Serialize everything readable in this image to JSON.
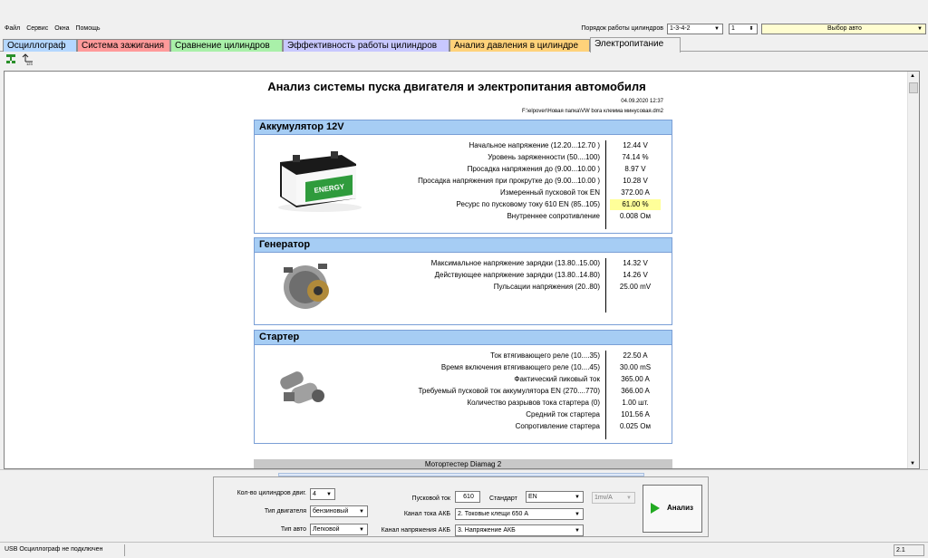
{
  "menu": {
    "items": [
      "Файл",
      "Сервис",
      "Окна",
      "Помощь"
    ]
  },
  "topbar": {
    "firing_order_label": "Порядок работы цилиндров",
    "firing_order": "1-3-4-2",
    "cylinder": "1",
    "car_select": "Выбор авто"
  },
  "tabs": [
    {
      "label": "Осциллограф",
      "color": "#b4d7ff"
    },
    {
      "label": "Система зажигания",
      "color": "#ff9a9a"
    },
    {
      "label": "Сравнение цилиндров",
      "color": "#a9f0a9"
    },
    {
      "label": "Эффективность работы цилиндров",
      "color": "#c8c8ff"
    },
    {
      "label": "Анализ давления в цилиндре",
      "color": "#ffd27a"
    },
    {
      "label": "Электропитание",
      "color": "#f0f0f0"
    }
  ],
  "report": {
    "title": "Анализ системы пуска двигателя и электропитания автомобиля",
    "date": "04.09.2020 12:37",
    "path": "F:\\elpover\\Новая папка\\VW bora клемма минусовая.dm2",
    "footer": "Мотортестер Diamag 2",
    "sections": [
      {
        "title": "Аккумулятор 12V",
        "rows": [
          {
            "label": "Начальное напряжение (12.20...12.70 )",
            "value": "12.44 V"
          },
          {
            "label": "Уровень заряженности (50....100)",
            "value": "74.14 %"
          },
          {
            "label": "Просадка напряжения до (9.00...10.00 )",
            "value": "8.97 V"
          },
          {
            "label": "Просадка напряжения при прокрутке до (9.00...10.00 )",
            "value": "10.28 V"
          },
          {
            "label": "Измеренный пусковой ток  EN",
            "value": "372.00 A"
          },
          {
            "label": "Ресурс по пусковому току  610 EN (85..105)",
            "value": "61.00 %",
            "highlight": true
          },
          {
            "label": "Внутреннее сопротивление",
            "value": "0.008 Ом"
          }
        ]
      },
      {
        "title": "Генератор",
        "rows": [
          {
            "label": "Максимальное напряжение зарядки  (13.80..15.00)",
            "value": "14.32 V"
          },
          {
            "label": "Действующее напряжение зарядки (13.80..14.80)",
            "value": "14.26 V"
          },
          {
            "label": "Пульсации напряжения (20..80)",
            "value": "25.00 mV"
          }
        ]
      },
      {
        "title": "Стартер",
        "rows": [
          {
            "label": "Ток втягивающего реле (10....35)",
            "value": "22.50 A"
          },
          {
            "label": "Время включения втягивающего реле (10....45)",
            "value": "30.00 mS"
          },
          {
            "label": "Фактический пиковый ток",
            "value": "365.00 A"
          },
          {
            "label": "Требуемый пусковой ток аккумулятора  EN (270....770)",
            "value": "366.00 A"
          },
          {
            "label": "Количество разрывов тока стартера (0)",
            "value": "1.00 шт."
          },
          {
            "label": "Средний ток стартера",
            "value": "101.56 A"
          },
          {
            "label": "Сопротивление стартера",
            "value": "0.025 Ом"
          }
        ]
      }
    ]
  },
  "controls": {
    "cyl_count_label": "Кол-во цилиндров двиг.",
    "cyl_count": "4",
    "engine_type_label": "Тип двигателя",
    "engine_type": "бензиновый",
    "car_type_label": "Тип авто",
    "car_type": "Легковой",
    "start_current_label": "Пусковой ток",
    "start_current": "610",
    "standard_label": "Стандарт",
    "standard": "EN",
    "battery_channel_label": "Канал тока АКБ",
    "battery_channel": "2. Токовые клещи 650 А",
    "voltage_channel_label": "Канал напряжения АКБ",
    "voltage_channel": "3. Напряжение АКБ",
    "scale": "1mv/A",
    "analyze_label": "Анализ"
  },
  "status": {
    "text": "USB Осциллограф не подключен",
    "version": "2.1"
  }
}
